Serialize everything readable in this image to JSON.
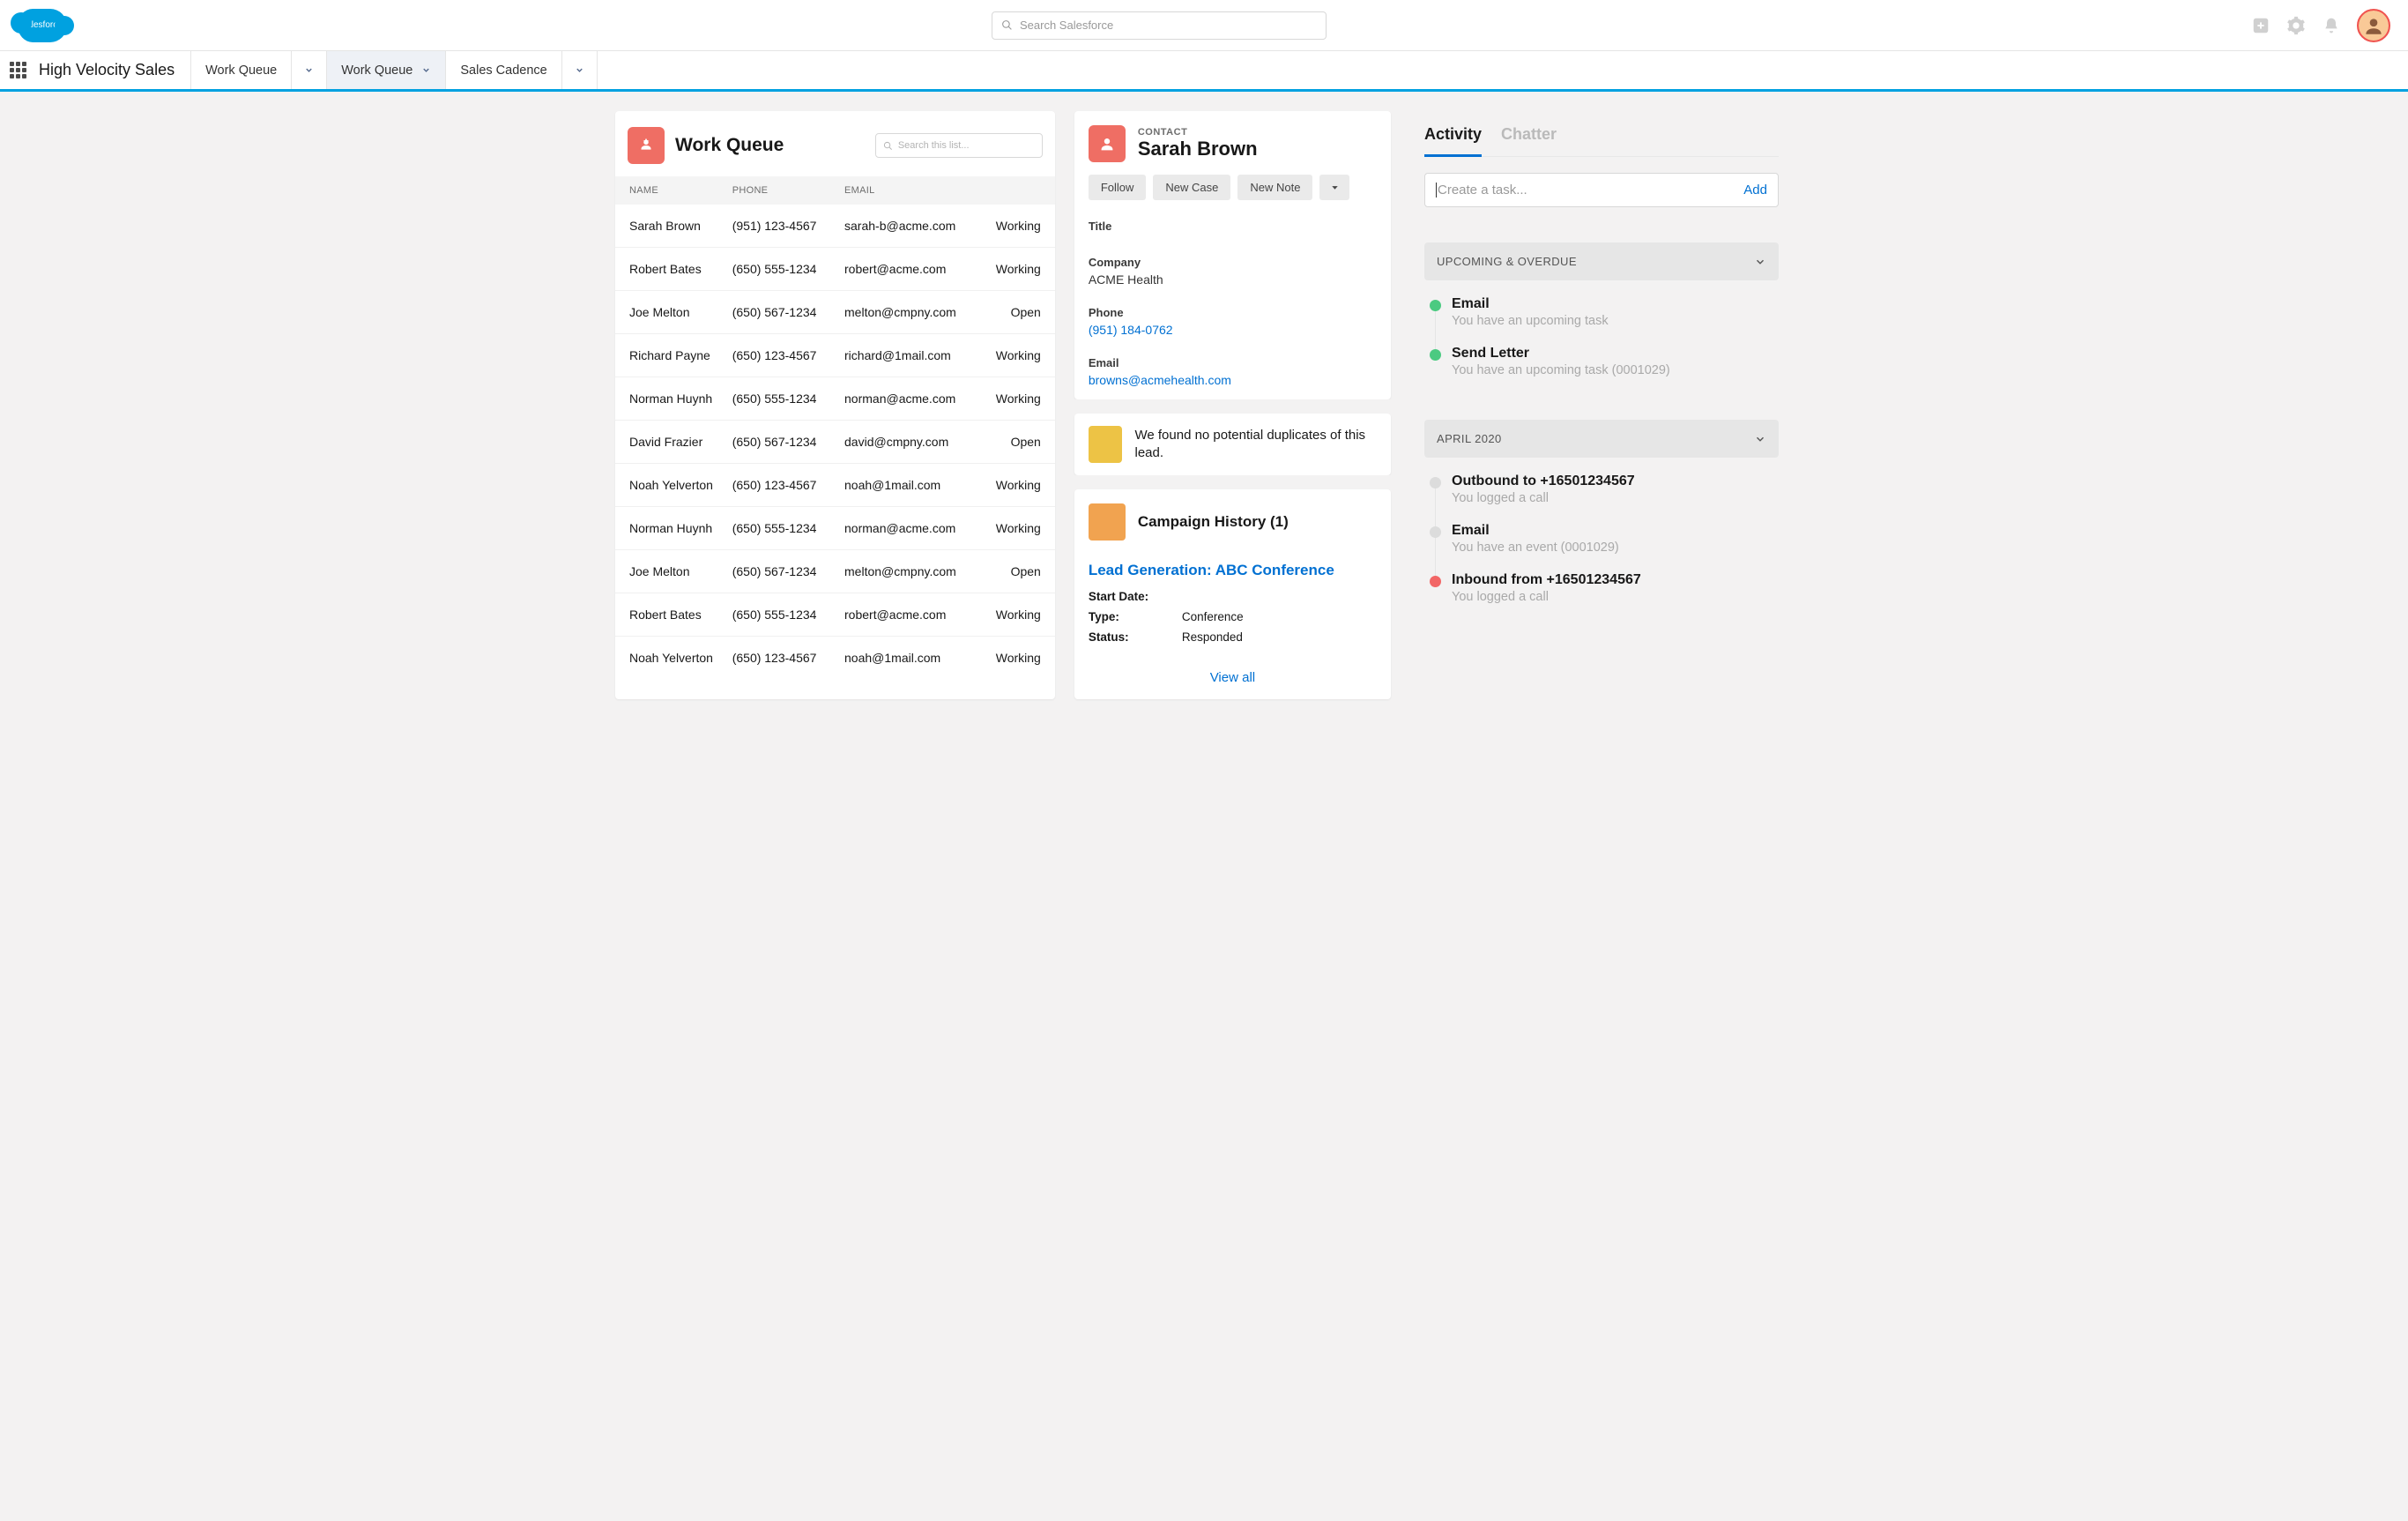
{
  "header": {
    "brand": "salesforce",
    "search_placeholder": "Search Salesforce"
  },
  "nav": {
    "app_name": "High Velocity Sales",
    "tabs": [
      "Work Queue",
      "Work Queue",
      "Sales Cadence"
    ]
  },
  "work_queue": {
    "title": "Work Queue",
    "search_placeholder": "Search this list...",
    "columns": [
      "NAME",
      "PHONE",
      "EMAIL"
    ],
    "rows": [
      {
        "name": "Sarah Brown",
        "phone": "(951) 123-4567",
        "email": "sarah-b@acme.com",
        "status": "Working"
      },
      {
        "name": "Robert Bates",
        "phone": "(650) 555-1234",
        "email": "robert@acme.com",
        "status": "Working"
      },
      {
        "name": "Joe Melton",
        "phone": "(650) 567-1234",
        "email": "melton@cmpny.com",
        "status": "Open"
      },
      {
        "name": "Richard Payne",
        "phone": "(650) 123-4567",
        "email": "richard@1mail.com",
        "status": "Working"
      },
      {
        "name": "Norman Huynh",
        "phone": "(650) 555-1234",
        "email": "norman@acme.com",
        "status": "Working"
      },
      {
        "name": "David Frazier",
        "phone": "(650) 567-1234",
        "email": "david@cmpny.com",
        "status": "Open"
      },
      {
        "name": "Noah Yelverton",
        "phone": "(650) 123-4567",
        "email": "noah@1mail.com",
        "status": "Working"
      },
      {
        "name": "Norman Huynh",
        "phone": "(650) 555-1234",
        "email": "norman@acme.com",
        "status": "Working"
      },
      {
        "name": "Joe Melton",
        "phone": "(650) 567-1234",
        "email": "melton@cmpny.com",
        "status": "Open"
      },
      {
        "name": "Robert Bates",
        "phone": "(650) 555-1234",
        "email": "robert@acme.com",
        "status": "Working"
      },
      {
        "name": "Noah Yelverton",
        "phone": "(650) 123-4567",
        "email": "noah@1mail.com",
        "status": "Working"
      }
    ]
  },
  "contact": {
    "label": "CONTACT",
    "name": "Sarah Brown",
    "actions": {
      "follow": "Follow",
      "new_case": "New Case",
      "new_note": "New Note"
    },
    "fields": {
      "title_label": "Title",
      "title_value": "",
      "company_label": "Company",
      "company_value": "ACME Health",
      "phone_label": "Phone",
      "phone_value": "(951) 184-0762",
      "email_label": "Email",
      "email_value": "browns@acmehealth.com"
    },
    "dup_msg": "We found no potential duplicates of this lead.",
    "campaign_title": "Campaign History (1)",
    "campaign_link": "Lead Generation: ABC Conference",
    "campaign_fields": {
      "start_label": "Start Date:",
      "start_val": "",
      "type_label": "Type:",
      "type_val": "Conference",
      "status_label": "Status:",
      "status_val": "Responded"
    },
    "view_all": "View all"
  },
  "activity": {
    "tabs": {
      "activity": "Activity",
      "chatter": "Chatter"
    },
    "task_placeholder": "Create a task...",
    "add_label": "Add",
    "sections": {
      "upcoming": "UPCOMING & OVERDUE",
      "april": "APRIL 2020"
    },
    "upcoming_items": [
      {
        "title": "Email",
        "sub": "You have an upcoming task",
        "color": "green"
      },
      {
        "title": "Send Letter",
        "sub": "You have an upcoming task (0001029)",
        "color": "green"
      }
    ],
    "april_items": [
      {
        "title": "Outbound to +16501234567",
        "sub": "You logged a call",
        "color": "grey"
      },
      {
        "title": "Email",
        "sub": "You have an event (0001029)",
        "color": "grey"
      },
      {
        "title": "Inbound from +16501234567",
        "sub": "You logged a call",
        "color": "red"
      }
    ]
  }
}
